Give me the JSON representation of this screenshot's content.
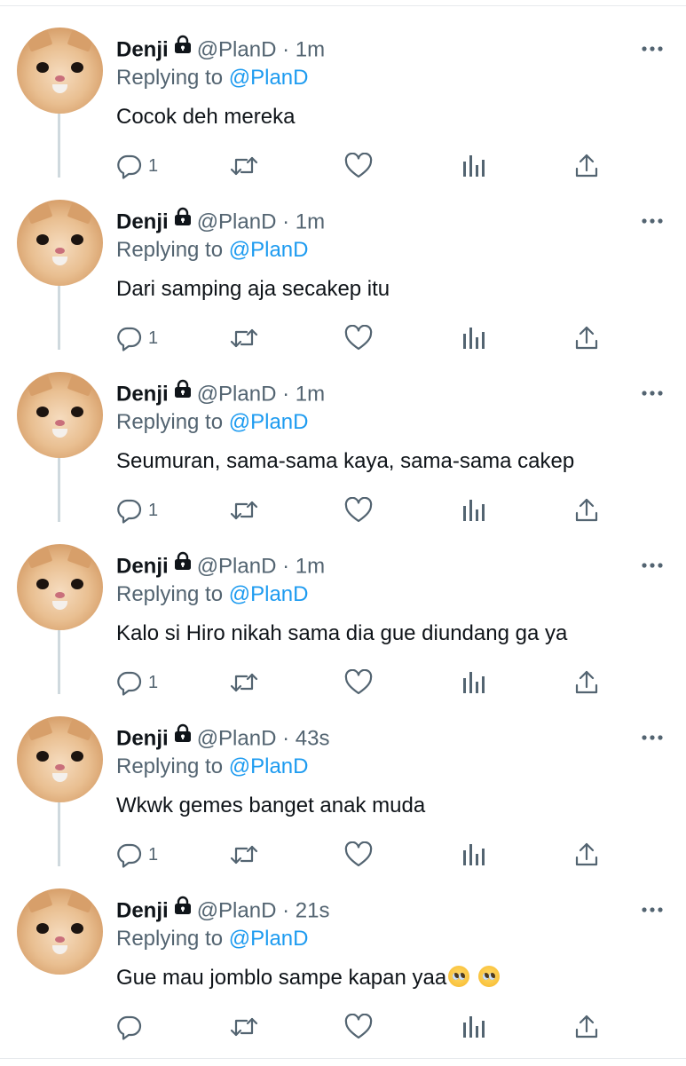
{
  "tweets": [
    {
      "author": "Denji",
      "handle": "@PlanD",
      "time": "1m",
      "replying_label": "Replying to",
      "replying_to": "@PlanD",
      "text": "Cocok deh mereka",
      "emoji_count": 0,
      "reply_count": "1",
      "has_thread_line": true
    },
    {
      "author": "Denji",
      "handle": "@PlanD",
      "time": "1m",
      "replying_label": "Replying to",
      "replying_to": "@PlanD",
      "text": "Dari samping aja secakep itu",
      "emoji_count": 0,
      "reply_count": "1",
      "has_thread_line": true
    },
    {
      "author": "Denji",
      "handle": "@PlanD",
      "time": "1m",
      "replying_label": "Replying to",
      "replying_to": "@PlanD",
      "text": "Seumuran, sama-sama kaya, sama-sama cakep",
      "emoji_count": 0,
      "reply_count": "1",
      "has_thread_line": true
    },
    {
      "author": "Denji",
      "handle": "@PlanD",
      "time": "1m",
      "replying_label": "Replying to",
      "replying_to": "@PlanD",
      "text": "Kalo si Hiro nikah sama dia gue diundang ga ya",
      "emoji_count": 0,
      "reply_count": "1",
      "has_thread_line": true
    },
    {
      "author": "Denji",
      "handle": "@PlanD",
      "time": "43s",
      "replying_label": "Replying to",
      "replying_to": "@PlanD",
      "text": "Wkwk gemes banget anak muda",
      "emoji_count": 0,
      "reply_count": "1",
      "has_thread_line": true
    },
    {
      "author": "Denji",
      "handle": "@PlanD",
      "time": "21s",
      "replying_label": "Replying to",
      "replying_to": "@PlanD",
      "text": "Gue mau jomblo sampe kapan yaa",
      "emoji_count": 2,
      "emoji_name": "pleading-face-emoji",
      "reply_count": "",
      "has_thread_line": false
    }
  ],
  "separator": "·",
  "icons": {
    "avatar": "cat-avatar",
    "lock": "lock-icon",
    "more": "more-options-icon",
    "reply": "reply-icon",
    "retweet": "retweet-icon",
    "like": "heart-icon",
    "analytics": "analytics-icon",
    "share": "share-icon"
  },
  "colors": {
    "link": "#1d9bf0",
    "secondary": "#536471",
    "text": "#0f1419",
    "thread_line": "#cfd9de"
  }
}
